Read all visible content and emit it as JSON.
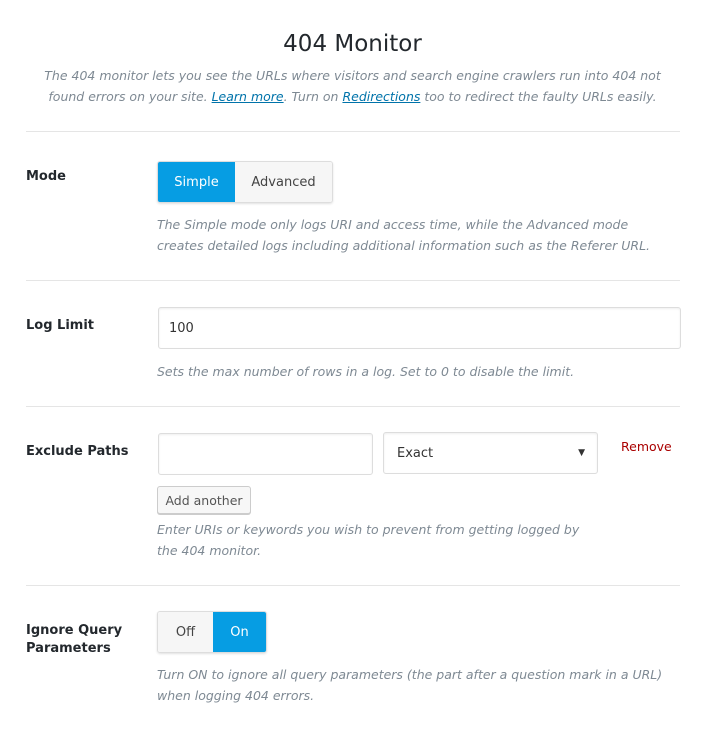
{
  "header": {
    "title": "404 Monitor",
    "intro_1": "The 404 monitor lets you see the URLs where visitors and search engine crawlers run into 404 not found errors on your site. ",
    "learn_more": "Learn more",
    "intro_2": ". Turn on ",
    "redirections": "Redirections",
    "intro_3": " too to redirect the faulty URLs easily."
  },
  "mode": {
    "label": "Mode",
    "options": [
      "Simple",
      "Advanced"
    ],
    "selected": "Simple",
    "description": "The Simple mode only logs URI and access time, while the Advanced mode creates detailed logs including additional information such as the Referer URL."
  },
  "log_limit": {
    "label": "Log Limit",
    "value": "100",
    "description": "Sets the max number of rows in a log. Set to 0 to disable the limit."
  },
  "exclude_paths": {
    "label": "Exclude Paths",
    "path_value": "",
    "match_type": "Exact",
    "remove_label": "Remove",
    "add_label": "Add another",
    "description_1": "Enter URIs or keywords you wish to prevent from getting logged by",
    "description_2": "the 404 monitor."
  },
  "ignore_query": {
    "label": "Ignore Query Parameters",
    "options": [
      "Off",
      "On"
    ],
    "selected": "On",
    "description": "Turn ON to ignore all query parameters (the part after a question mark in a URL) when logging 404 errors."
  },
  "colors": {
    "accent": "#069de3",
    "remove": "#aa0000",
    "link": "#0073aa"
  }
}
